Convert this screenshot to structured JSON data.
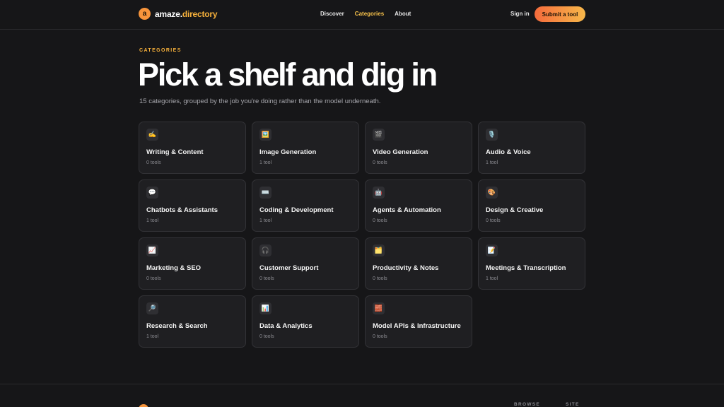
{
  "header": {
    "brand_mark": "a",
    "brand_name": "amaze.",
    "brand_tld": "directory",
    "nav": [
      "Discover",
      "Categories",
      "About"
    ],
    "nav_active": "Categories",
    "signin": "Sign in",
    "submit": "Submit a tool"
  },
  "hero": {
    "eyebrow": "CATEGORIES",
    "title": "Pick a shelf and dig in",
    "subtitle": "15 categories, grouped by the job you're doing rather than the model underneath."
  },
  "categories": [
    {
      "icon": "writing-hand-icon",
      "glyph": "✍️",
      "name": "Writing & Content",
      "count": "0 tools"
    },
    {
      "icon": "framed-picture-icon",
      "glyph": "🖼️",
      "name": "Image Generation",
      "count": "1 tool"
    },
    {
      "icon": "clapper-board-icon",
      "glyph": "🎬",
      "name": "Video Generation",
      "count": "0 tools"
    },
    {
      "icon": "microphone-icon",
      "glyph": "🎙️",
      "name": "Audio & Voice",
      "count": "1 tool"
    },
    {
      "icon": "speech-bubble-icon",
      "glyph": "💬",
      "name": "Chatbots & Assistants",
      "count": "1 tool"
    },
    {
      "icon": "keyboard-icon",
      "glyph": "⌨️",
      "name": "Coding & Development",
      "count": "1 tool"
    },
    {
      "icon": "robot-icon",
      "glyph": "🤖",
      "name": "Agents & Automation",
      "count": "0 tools"
    },
    {
      "icon": "palette-icon",
      "glyph": "🎨",
      "name": "Design & Creative",
      "count": "0 tools"
    },
    {
      "icon": "chart-increasing-icon",
      "glyph": "📈",
      "name": "Marketing & SEO",
      "count": "0 tools"
    },
    {
      "icon": "headphone-icon",
      "glyph": "🎧",
      "name": "Customer Support",
      "count": "0 tools"
    },
    {
      "icon": "card-index-dividers-icon",
      "glyph": "🗂️",
      "name": "Productivity & Notes",
      "count": "0 tools"
    },
    {
      "icon": "memo-icon",
      "glyph": "📝",
      "name": "Meetings & Transcription",
      "count": "1 tool"
    },
    {
      "icon": "magnifying-glass-icon",
      "glyph": "🔎",
      "name": "Research & Search",
      "count": "1 tool"
    },
    {
      "icon": "bar-chart-icon",
      "glyph": "📊",
      "name": "Data & Analytics",
      "count": "0 tools"
    },
    {
      "icon": "brick-icon",
      "glyph": "🧱",
      "name": "Model APIs & Infrastructure",
      "count": "0 tools"
    }
  ],
  "footer": {
    "columns": [
      "BROWSE",
      "SITE"
    ]
  },
  "colors": {
    "background": "#161618",
    "card": "#1f1f22",
    "accent": "#f7b13b",
    "accent_gradient_start": "#f56b3c",
    "accent_gradient_end": "#f7b84a"
  }
}
